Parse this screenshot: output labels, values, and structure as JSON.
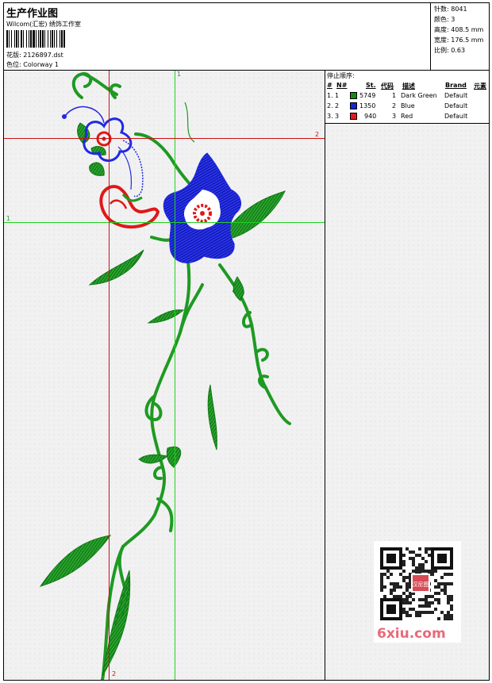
{
  "header": {
    "title": "生产作业图",
    "company": "Wilcom(汇宏) 绣饰工作室",
    "design_label": "花版: 2126897.dst",
    "colorway_label": "色位:   Colorway 1"
  },
  "stats": [
    {
      "label": "针数:",
      "value": "8041"
    },
    {
      "label": "颜色:",
      "value": "3"
    },
    {
      "label": "高度:",
      "value": "408.5 mm"
    },
    {
      "label": "宽度:",
      "value": "176.5 mm"
    },
    {
      "label": "比例:",
      "value": "0.63"
    }
  ],
  "canvas": {
    "guide_labels": {
      "v_green": "1",
      "h_green": "1",
      "h_red": "2",
      "v_red": "2"
    }
  },
  "stop_sequence": {
    "title": "停止顺序:",
    "columns": [
      "#",
      "N#",
      "St.",
      "代码",
      "描述",
      "Brand",
      "元素"
    ],
    "rows": [
      {
        "idx": "1.",
        "n": "1",
        "stitches": "5749",
        "code": "1",
        "desc": "Dark Green",
        "brand": "Default",
        "color": "#128c17"
      },
      {
        "idx": "2.",
        "n": "2",
        "stitches": "1350",
        "code": "2",
        "desc": "Blue",
        "brand": "Default",
        "color": "#1a23d4"
      },
      {
        "idx": "3.",
        "n": "3",
        "stitches": "940",
        "code": "3",
        "desc": "Red",
        "brand": "Default",
        "color": "#e11b1b"
      }
    ]
  },
  "watermark": {
    "text": "6xiu.com",
    "seal": "汉尼图"
  },
  "colors": {
    "green": "#1e9a22",
    "blue": "#1f2ae0",
    "red": "#e01818",
    "guide_green": "#20d020",
    "guide_red": "#c81010"
  }
}
